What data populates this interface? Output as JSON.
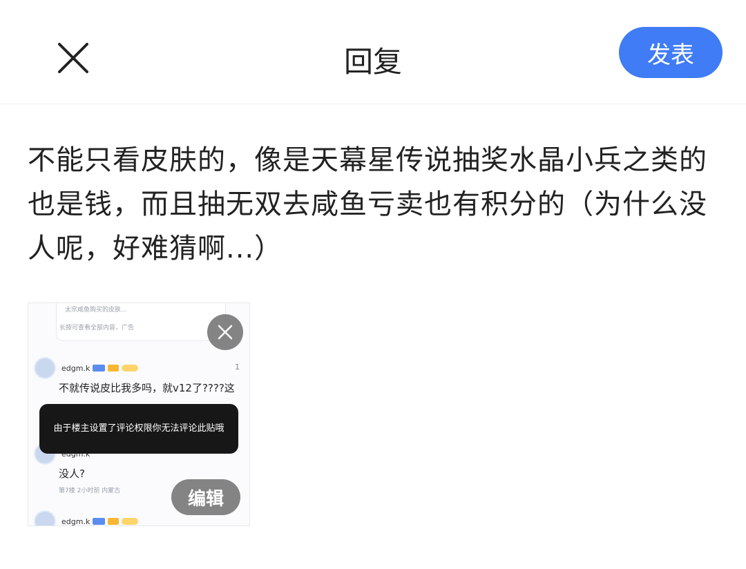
{
  "header": {
    "title": "回复",
    "publish_label": "发表",
    "close_icon": "close-icon",
    "accent_color": "#3f7cf5"
  },
  "post": {
    "text": "不能只看皮肤的，像是天幕星传说抽奖水晶小兵之类的也是钱，而且抽无双去咸鱼亏卖也有积分的（为什么没人呢，好难猜啊...）"
  },
  "attachment": {
    "remove_icon": "close-icon",
    "edit_label": "编辑",
    "screenshot": {
      "top_line_1": "太宗咸鱼购买的皮肤...",
      "top_line_2": "长按可查看全部内容，广告",
      "comments": [
        {
          "user": "edgm.k",
          "text": "不就传说皮比我多吗，就v12了????这",
          "like": "1"
        },
        {
          "user": "edgm.k",
          "text": "没人?",
          "meta": "第7楼 2小时前 内蒙古"
        },
        {
          "user": "edgm.k",
          "text": ""
        }
      ],
      "toast": "由于楼主设置了评论权限你无法评论此贴哦"
    }
  }
}
